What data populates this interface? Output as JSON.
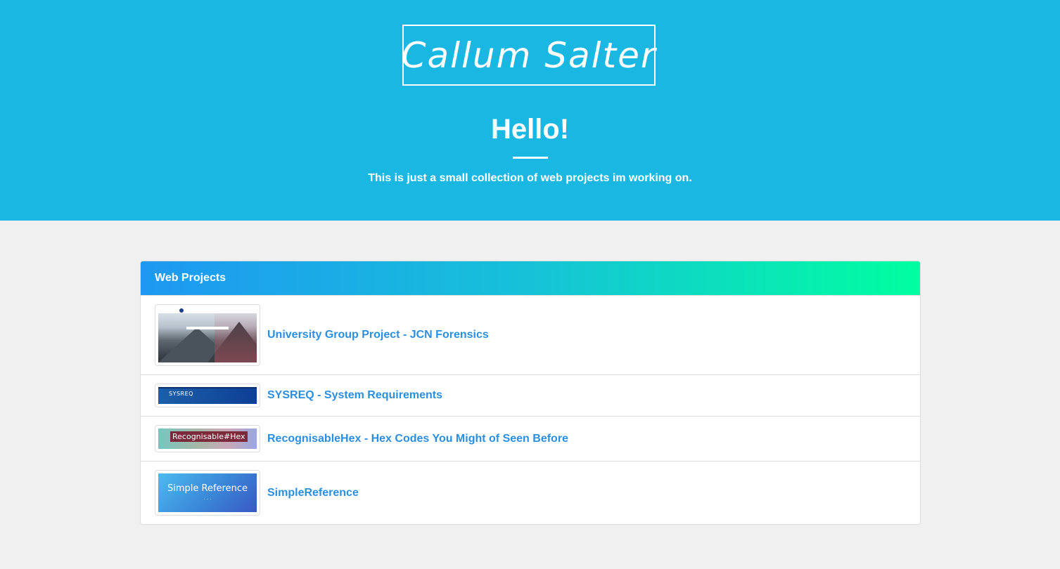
{
  "header": {
    "logo_text": "Callum Salter",
    "title": "Hello!",
    "subtitle": "This is just a small collection of web projects im working on."
  },
  "panel": {
    "title": "Web Projects",
    "projects": [
      {
        "label": "University Group Project - JCN Forensics",
        "thumbnail": "jcn-forensics-thumbnail"
      },
      {
        "label": "SYSREQ - System Requirements",
        "thumbnail": "sysreq-thumbnail",
        "thumb_text": "SYSREQ"
      },
      {
        "label": "RecognisableHex - Hex Codes You Might of Seen Before",
        "thumbnail": "recognisablehex-thumbnail",
        "thumb_text": "Recognisable#Hex"
      },
      {
        "label": "SimpleReference",
        "thumbnail": "simplereference-thumbnail",
        "thumb_text": "Simple Reference"
      }
    ]
  },
  "colors": {
    "hero_background": "#1ab7e2",
    "page_background": "#f0f0f0",
    "link": "#2b8fe0",
    "panel_gradient_start": "#1e98f2",
    "panel_gradient_end": "#00ffa0"
  }
}
